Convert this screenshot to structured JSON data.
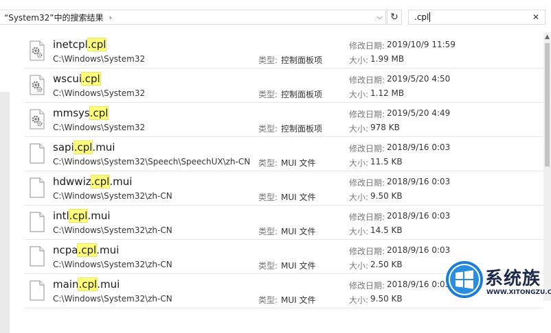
{
  "address": {
    "path": "“System32”中的搜索结果",
    "crumb_arrow": "›",
    "dropdown": "⌵"
  },
  "refresh_glyph": "↻",
  "search": {
    "query": ".cpl",
    "clear": "✕"
  },
  "labels": {
    "type": "类型:",
    "modified": "修改日期:",
    "size": "大小:"
  },
  "highlight": {
    "color": "#ffff7a"
  },
  "rows": [
    {
      "pre": "inetcpl",
      "hl": ".cpl",
      "post": "",
      "icon": "cpl-gear-icon",
      "location": "C:\\Windows\\System32",
      "type": "控制面板项",
      "date": "2019/10/9 11:59",
      "size": "1.99 MB"
    },
    {
      "pre": "wscui",
      "hl": ".cpl",
      "post": "",
      "icon": "cpl-gear-icon",
      "location": "C:\\Windows\\System32",
      "type": "控制面板项",
      "date": "2019/5/20 4:50",
      "size": "1.12 MB"
    },
    {
      "pre": "mmsys",
      "hl": ".cpl",
      "post": "",
      "icon": "cpl-gear-icon",
      "location": "C:\\Windows\\System32",
      "type": "控制面板项",
      "date": "2019/5/20 4:49",
      "size": "978 KB"
    },
    {
      "pre": "sapi",
      "hl": ".cpl",
      "post": ".mui",
      "icon": "file-icon",
      "location": "C:\\Windows\\System32\\Speech\\SpeechUX\\zh-CN",
      "type": "MUI 文件",
      "date": "2018/9/16 0:03",
      "size": "11.5 KB"
    },
    {
      "pre": "hdwwiz",
      "hl": ".cpl",
      "post": ".mui",
      "icon": "file-icon",
      "location": "C:\\Windows\\System32\\zh-CN",
      "type": "MUI 文件",
      "date": "2018/9/16 0:03",
      "size": "9.50 KB"
    },
    {
      "pre": "intl",
      "hl": ".cpl",
      "post": ".mui",
      "icon": "file-icon",
      "location": "C:\\Windows\\System32\\zh-CN",
      "type": "MUI 文件",
      "date": "2018/9/16 0:03",
      "size": "14.5 KB"
    },
    {
      "pre": "ncpa",
      "hl": ".cpl",
      "post": ".mui",
      "icon": "file-icon",
      "location": "C:\\Windows\\System32\\zh-CN",
      "type": "MUI 文件",
      "date": "2018/9/16 0:03",
      "size": "2.50 KB"
    },
    {
      "pre": "main",
      "hl": ".cpl",
      "post": ".mui",
      "icon": "file-icon",
      "location": "C:\\Windows\\System32\\zh-CN",
      "type": "MUI 文件",
      "date": "2018/9/16 0:03",
      "size": "9.50 KB"
    }
  ],
  "watermark": {
    "brand": "系统族",
    "url": "WWW.XITONGZU.COM"
  }
}
